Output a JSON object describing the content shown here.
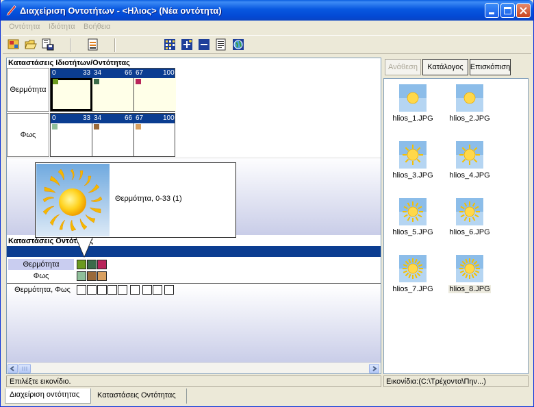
{
  "window": {
    "title": "Διαχείριση Οντοτήτων - <Ηλιος> (Νέα οντότητα)"
  },
  "menu": [
    "Οντότητα",
    "Ιδιότητα",
    "Βοήθεια"
  ],
  "toolbar_icons": [
    "new-icon",
    "open-icon",
    "save-icon",
    "export-icon",
    "grid-icon",
    "add-icon",
    "remove-icon",
    "document-icon",
    "globe-icon"
  ],
  "property_states": {
    "title": "Καταστάσεις Ιδιοτήτων/Οντότητας",
    "rows": [
      {
        "label": "Θερμότητα",
        "ranges": [
          "0",
          "33",
          "34",
          "66",
          "67",
          "100"
        ],
        "swatches": [
          "#6b9a1f",
          "#3c6b4a",
          "#b8255a"
        ],
        "cell_bg": "#ffffe8"
      },
      {
        "label": "Φως",
        "ranges": [
          "0",
          "33",
          "34",
          "66",
          "67",
          "100"
        ],
        "swatches": [
          "#8fbf9a",
          "#9a6a3a",
          "#d9a060"
        ],
        "cell_bg": "#ffffff"
      }
    ]
  },
  "tooltip": {
    "text": "Θερμότητα, 0-33 (1)"
  },
  "entity_states": {
    "title": "Καταστάσεις Οντότητας",
    "rows": [
      {
        "label": "Θερμότητα",
        "colors": [
          "#6b9a1f",
          "#3c6b4a",
          "#b8255a"
        ]
      },
      {
        "label": "Φως",
        "colors": [
          "#8fbf9a",
          "#9a6a3a",
          "#d9a060"
        ]
      },
      {
        "label": "Θερμότητα, Φως",
        "empty_count": 9
      }
    ]
  },
  "status": {
    "left": "Επιλέξτε εικονίδιο.",
    "right": "Εικονίδια:(C:\\Τρέχοντα\\Πην...)"
  },
  "right_buttons": [
    {
      "label": "Ανάθεση",
      "enabled": false
    },
    {
      "label": "Κατάλογος",
      "enabled": true
    },
    {
      "label": "Επισκόπιση",
      "enabled": true
    }
  ],
  "images": [
    {
      "name": "hlios_1.JPG",
      "rays": 0
    },
    {
      "name": "hlios_2.JPG",
      "rays": 0
    },
    {
      "name": "hlios_3.JPG",
      "rays": 1
    },
    {
      "name": "hlios_4.JPG",
      "rays": 1
    },
    {
      "name": "hlios_5.JPG",
      "rays": 2
    },
    {
      "name": "hlios_6.JPG",
      "rays": 2
    },
    {
      "name": "hlios_7.JPG",
      "rays": 3
    },
    {
      "name": "hlios_8.JPG",
      "rays": 3
    }
  ],
  "selected_image": "hlios_8.JPG",
  "tabs": [
    {
      "label": "Διαχείριση οντότητας",
      "active": true
    },
    {
      "label": "Καταστάσεις Οντότητας",
      "active": false
    }
  ]
}
